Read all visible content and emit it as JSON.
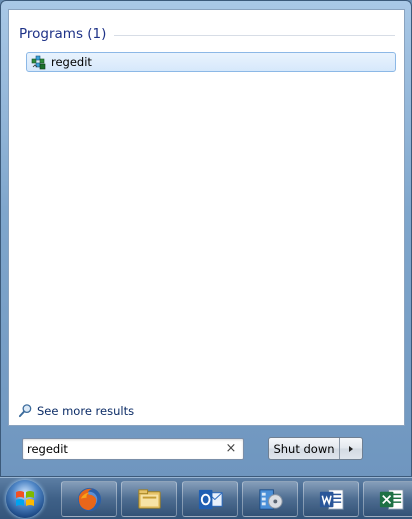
{
  "results": {
    "group_title": "Programs (1)",
    "items": [
      {
        "label": "regedit",
        "icon": "regedit-icon"
      }
    ]
  },
  "see_more": {
    "label": "See more results",
    "icon": "magnifier-icon"
  },
  "search": {
    "value": "regedit",
    "clear_glyph": "×"
  },
  "shutdown": {
    "label": "Shut down",
    "arrow_glyph": "▸"
  },
  "taskbar": {
    "start": "windows-orb-icon",
    "pinned": [
      "firefox-icon",
      "explorer-icon",
      "outlook-icon",
      "media-center-icon",
      "word-icon",
      "excel-icon"
    ]
  },
  "colors": {
    "group_title": "#1e3287",
    "selection_fill": "#d6e8fb",
    "selection_border": "#8cb8e6",
    "link": "#0c2c66",
    "taskbar": "#3f6188"
  }
}
